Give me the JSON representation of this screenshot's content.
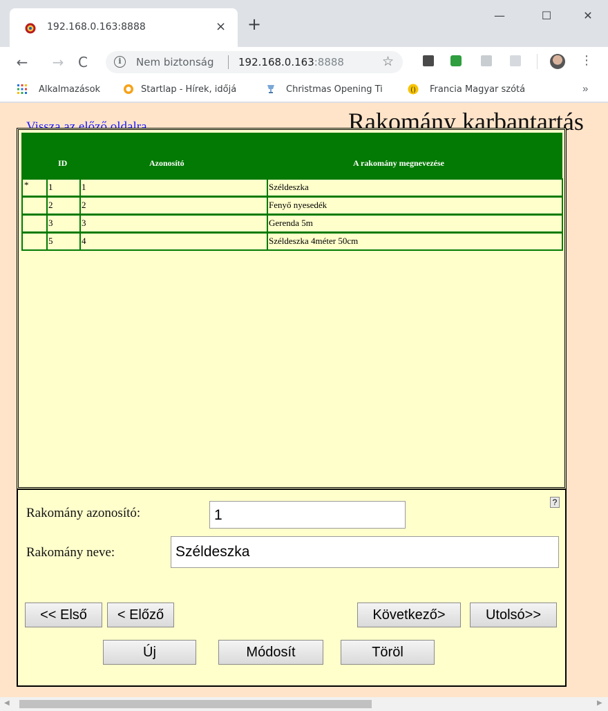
{
  "browser": {
    "tab_title": "192.168.0.163:8888",
    "tab_close": "×",
    "new_tab": "+",
    "window_controls": {
      "minimize": "—",
      "maximize": "☐",
      "close": "✕"
    },
    "nav": {
      "back": "←",
      "forward": "→",
      "reload": "C"
    },
    "security_label": "Nem biztonság",
    "url_host": "192.168.0.163",
    "url_port": ":8888",
    "bookmarks": [
      {
        "label": "Alkalmazások",
        "icon": "apps-grid-icon"
      },
      {
        "label": "Startlap - Hírek, időjá",
        "icon": "startlap-icon"
      },
      {
        "label": "Christmas Opening Ti",
        "icon": "trophy-icon"
      },
      {
        "label": "Francia Magyar szótá",
        "icon": "dictionary-icon"
      }
    ],
    "bookmarks_more": "»"
  },
  "page": {
    "back_link": "Vissza az előző oldalra",
    "title": "Rakomány karbantartás"
  },
  "grid": {
    "columns": [
      "ID",
      "Azonosító",
      "A rakomány megnevezése"
    ],
    "current_marker": "*",
    "rows": [
      {
        "id": "1",
        "code": "1",
        "name": "Széldeszka"
      },
      {
        "id": "2",
        "code": "2",
        "name": "Fenyő nyesedék"
      },
      {
        "id": "3",
        "code": "3",
        "name": "Gerenda 5m"
      },
      {
        "id": "5",
        "code": "4",
        "name": "Széldeszka 4méter 50cm"
      }
    ]
  },
  "form": {
    "help": "?",
    "code_label": "Rakomány azonosító:",
    "code_value": "1",
    "name_label": "Rakomány neve:",
    "name_value": "Széldeszka"
  },
  "buttons": {
    "first": "<< Első",
    "prev": "< Előző",
    "next": "Következő>",
    "last": "Utolsó>>",
    "new": "Új",
    "modify": "Módosít",
    "delete": "Töröl"
  },
  "colors": {
    "page_bg": "#ffe4c9",
    "grid_header": "#037a03",
    "grid_bg": "#ffffcc",
    "link": "#1a1aff"
  }
}
